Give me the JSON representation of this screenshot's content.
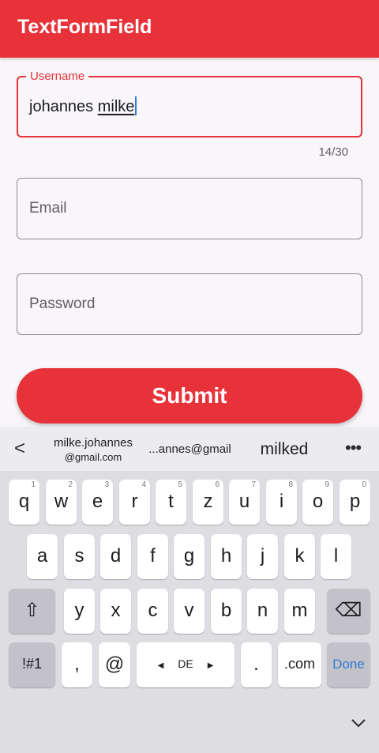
{
  "appbar": {
    "title": "TextFormField"
  },
  "form": {
    "username": {
      "label": "Username",
      "value_plain": "johannes ",
      "value_underlined": "milke",
      "counter": "14/30"
    },
    "email": {
      "placeholder": "Email"
    },
    "password": {
      "placeholder": "Password"
    },
    "submit_label": "Submit"
  },
  "keyboard": {
    "suggestions": {
      "back_glyph": "<",
      "s1_line1": "milke.johannes",
      "s1_line2": "@gmail.com",
      "s2": "...annes@gmail",
      "s3": "milked",
      "more_glyph": "•••"
    },
    "row1": [
      {
        "k": "q",
        "h": "1"
      },
      {
        "k": "w",
        "h": "2"
      },
      {
        "k": "e",
        "h": "3"
      },
      {
        "k": "r",
        "h": "4"
      },
      {
        "k": "t",
        "h": "5"
      },
      {
        "k": "z",
        "h": "6"
      },
      {
        "k": "u",
        "h": "7"
      },
      {
        "k": "i",
        "h": "8"
      },
      {
        "k": "o",
        "h": "9"
      },
      {
        "k": "p",
        "h": "0"
      }
    ],
    "row2": [
      "a",
      "s",
      "d",
      "f",
      "g",
      "h",
      "j",
      "k",
      "l"
    ],
    "row3": [
      "y",
      "x",
      "c",
      "v",
      "b",
      "n",
      "m"
    ],
    "shift_glyph": "⇧",
    "backspace_glyph": "⌫",
    "symbols_label": "!#1",
    "comma_label": ",",
    "at_label": "@",
    "space_label": "DE",
    "space_left": "◀",
    "space_right": "▶",
    "period_label": ".",
    "dotcom_label": ".com",
    "done_label": "Done"
  }
}
